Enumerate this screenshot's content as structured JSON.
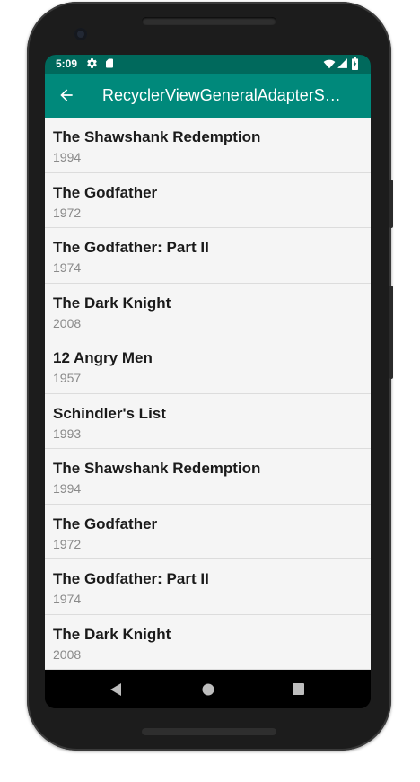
{
  "status_bar": {
    "time": "5:09",
    "icons": [
      "gear-icon",
      "sd-card-icon",
      "wifi-icon",
      "signal-icon",
      "battery-icon"
    ]
  },
  "app_bar": {
    "title": "RecyclerViewGeneralAdapterSa…",
    "nav_icon": "back-arrow-icon",
    "color": "#00897b",
    "status_color": "#00695c"
  },
  "movies": [
    {
      "title": "The Shawshank Redemption",
      "year": "1994"
    },
    {
      "title": "The Godfather",
      "year": "1972"
    },
    {
      "title": "The Godfather: Part II",
      "year": "1974"
    },
    {
      "title": "The Dark Knight",
      "year": "2008"
    },
    {
      "title": "12 Angry Men",
      "year": "1957"
    },
    {
      "title": "Schindler's List",
      "year": "1993"
    },
    {
      "title": "The Shawshank Redemption",
      "year": "1994"
    },
    {
      "title": "The Godfather",
      "year": "1972"
    },
    {
      "title": "The Godfather: Part II",
      "year": "1974"
    },
    {
      "title": "The Dark Knight",
      "year": "2008"
    }
  ],
  "nav_bar": {
    "buttons": [
      "back-triangle-icon",
      "home-circle-icon",
      "recents-square-icon"
    ]
  }
}
